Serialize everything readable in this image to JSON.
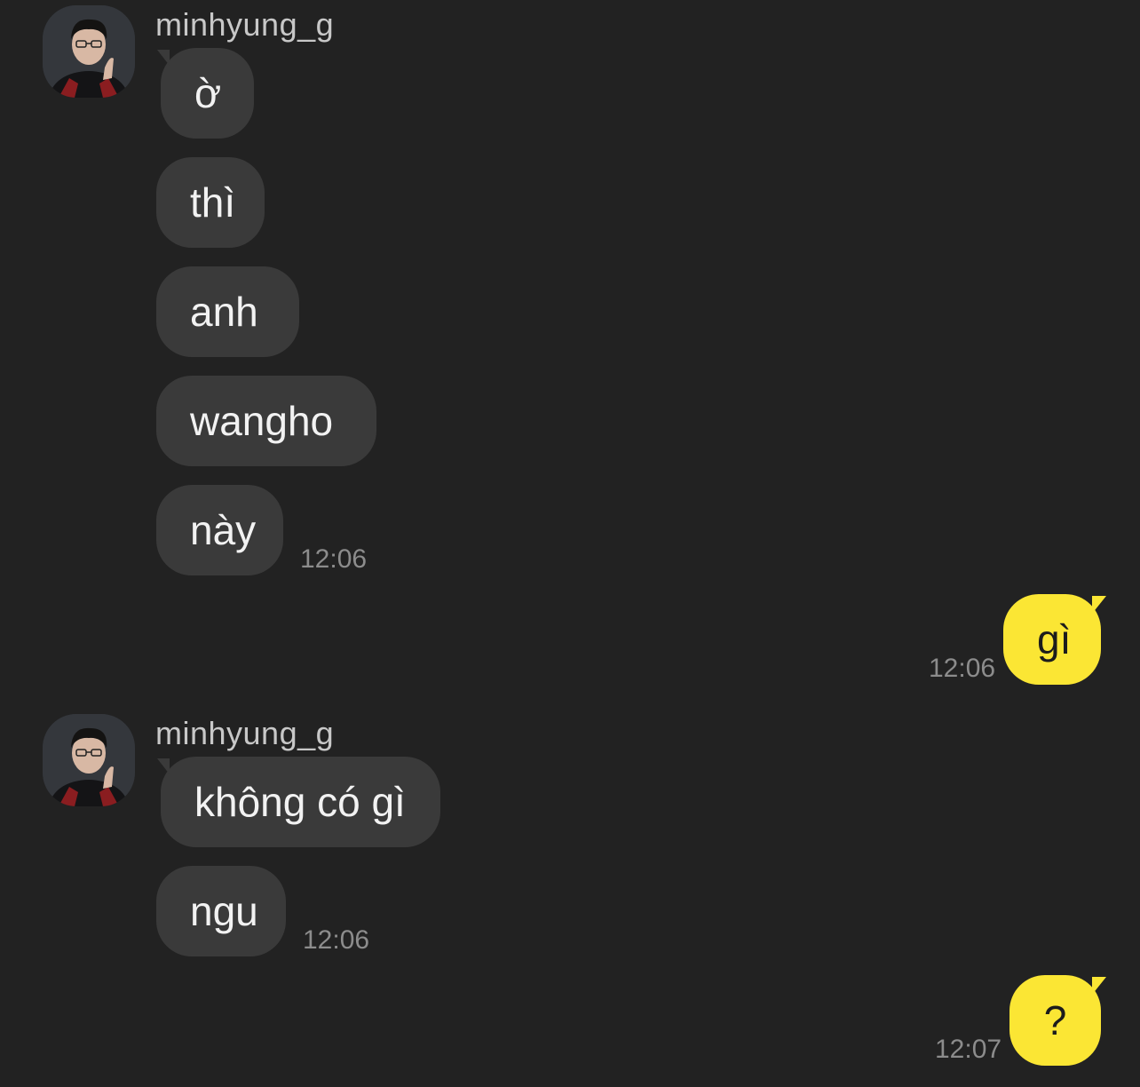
{
  "colors": {
    "background": "#222222",
    "incoming_bubble": "#3a3a3a",
    "outgoing_bubble": "#fbe634",
    "sender_name": "#c8c8c8",
    "timestamp": "#8c8c8c"
  },
  "groups": [
    {
      "sender": "minhyung_g",
      "avatar_icon": "profile-photo-avatar",
      "messages": [
        "ờ",
        "thì",
        "anh",
        "wangho",
        "này"
      ],
      "time": "12:06"
    },
    {
      "outgoing": true,
      "messages": [
        "gì"
      ],
      "time": "12:06"
    },
    {
      "sender": "minhyung_g",
      "avatar_icon": "profile-photo-avatar",
      "messages": [
        "không có gì",
        "ngu"
      ],
      "time": "12:06"
    },
    {
      "outgoing": true,
      "messages": [
        "?"
      ],
      "time": "12:07"
    }
  ]
}
